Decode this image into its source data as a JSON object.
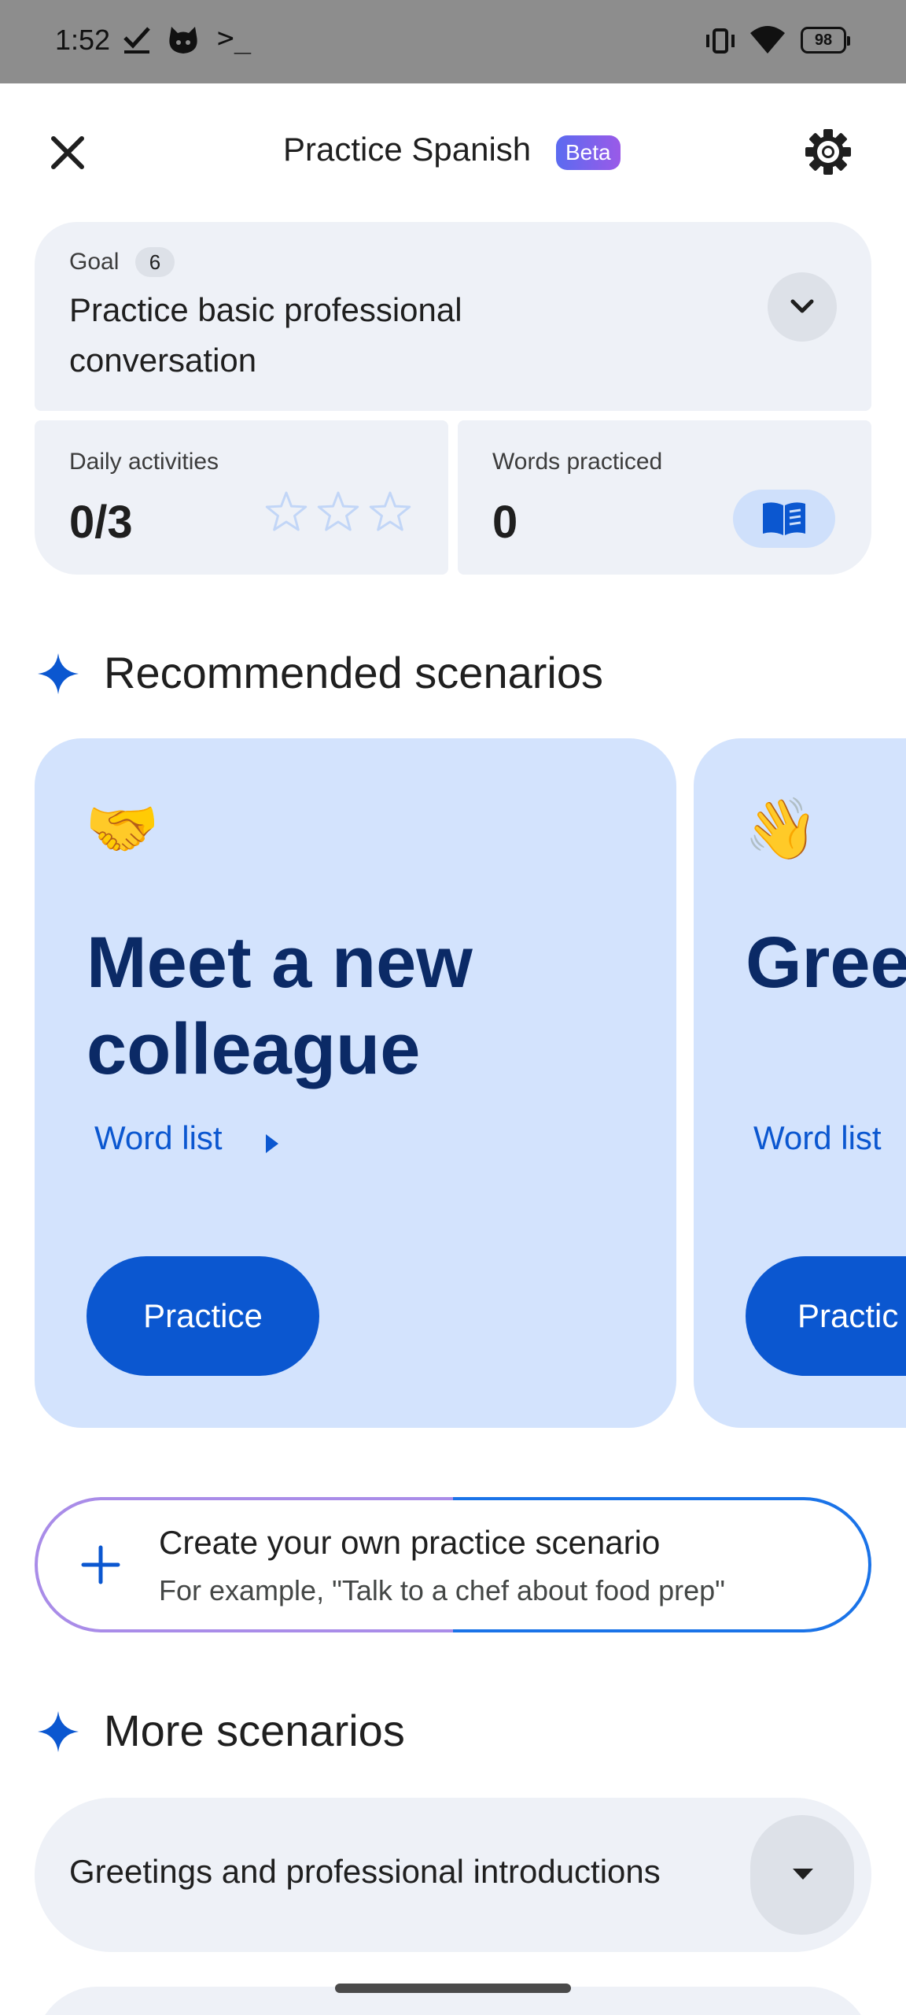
{
  "status_bar": {
    "time": "1:52",
    "battery": "98",
    "terminal_glyph": ">_"
  },
  "header": {
    "title": "Practice Spanish",
    "badge": "Beta"
  },
  "goal": {
    "label": "Goal",
    "count": "6",
    "text": "Practice basic professional conversation"
  },
  "stats": {
    "daily_label": "Daily activities",
    "daily_value": "0/3",
    "stars_filled": 0,
    "stars_total": 3,
    "words_label": "Words practiced",
    "words_value": "0"
  },
  "recommended": {
    "title": "Recommended scenarios",
    "cards": [
      {
        "emoji": "🤝",
        "title": "Meet a new colleague",
        "word_list": "Word list",
        "button": "Practice"
      },
      {
        "emoji": "👋",
        "title": "Greet in the",
        "word_list": "Word list",
        "button": "Practic"
      }
    ]
  },
  "create": {
    "title": "Create your own practice scenario",
    "subtitle": "For example, \"Talk to a chef about food prep\""
  },
  "more": {
    "title": "More scenarios",
    "items": [
      {
        "label": "Greetings and professional introductions"
      }
    ]
  },
  "colors": {
    "accent": "#0b57d0",
    "card_bg": "#d3e3fd",
    "surface": "#eef1f7",
    "title_dark": "#0b2a66"
  }
}
